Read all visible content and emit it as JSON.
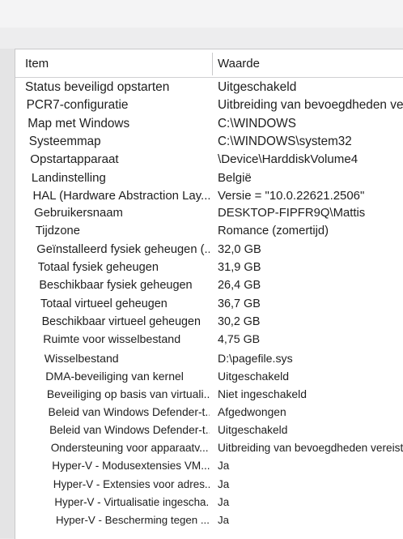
{
  "header": {
    "item": "Item",
    "value": "Waarde"
  },
  "rows": [
    {
      "item": "Status beveiligd opstarten",
      "value": "Uitgeschakeld"
    },
    {
      "item": "PCR7-configuratie",
      "value": "Uitbreiding van bevoegdheden ve"
    },
    {
      "item": "Map met Windows",
      "value": "C:\\WINDOWS"
    },
    {
      "item": "Systeemmap",
      "value": "C:\\WINDOWS\\system32"
    },
    {
      "item": "Opstartapparaat",
      "value": "\\Device\\HarddiskVolume4"
    },
    {
      "item": "Landinstelling",
      "value": "België"
    },
    {
      "item": "HAL (Hardware Abstraction Lay...",
      "value": "Versie = \"10.0.22621.2506\""
    },
    {
      "item": "Gebruikersnaam",
      "value": "DESKTOP-FIPFR9Q\\Mattis"
    },
    {
      "item": "Tijdzone",
      "value": "Romance (zomertijd)"
    },
    {
      "item": "Geïnstalleerd fysiek geheugen (...",
      "value": "32,0 GB"
    },
    {
      "item": "Totaal fysiek geheugen",
      "value": "31,9 GB"
    },
    {
      "item": "Beschikbaar fysiek geheugen",
      "value": "26,4 GB"
    },
    {
      "item": "Totaal virtueel geheugen",
      "value": "36,7 GB"
    },
    {
      "item": "Beschikbaar virtueel geheugen",
      "value": "30,2 GB"
    },
    {
      "item": "Ruimte voor wisselbestand",
      "value": "4,75 GB"
    },
    {
      "item": "Wisselbestand",
      "value": "D:\\pagefile.sys"
    },
    {
      "item": "DMA-beveiliging van kernel",
      "value": "Uitgeschakeld"
    },
    {
      "item": "Beveiliging op basis van virtuali...",
      "value": "Niet ingeschakeld"
    },
    {
      "item": "Beleid van Windows Defender-t...",
      "value": "Afgedwongen"
    },
    {
      "item": "Beleid van Windows Defender-t...",
      "value": "Uitgeschakeld"
    },
    {
      "item": "Ondersteuning voor apparaatv...",
      "value": "Uitbreiding van bevoegdheden vereist"
    },
    {
      "item": "Hyper-V - Modusextensies VM...",
      "value": "Ja"
    },
    {
      "item": "Hyper-V - Extensies voor adres...",
      "value": "Ja"
    },
    {
      "item": "Hyper-V - Virtualisatie ingescha...",
      "value": "Ja"
    },
    {
      "item": "Hyper-V - Bescherming tegen ...",
      "value": "Ja"
    }
  ]
}
